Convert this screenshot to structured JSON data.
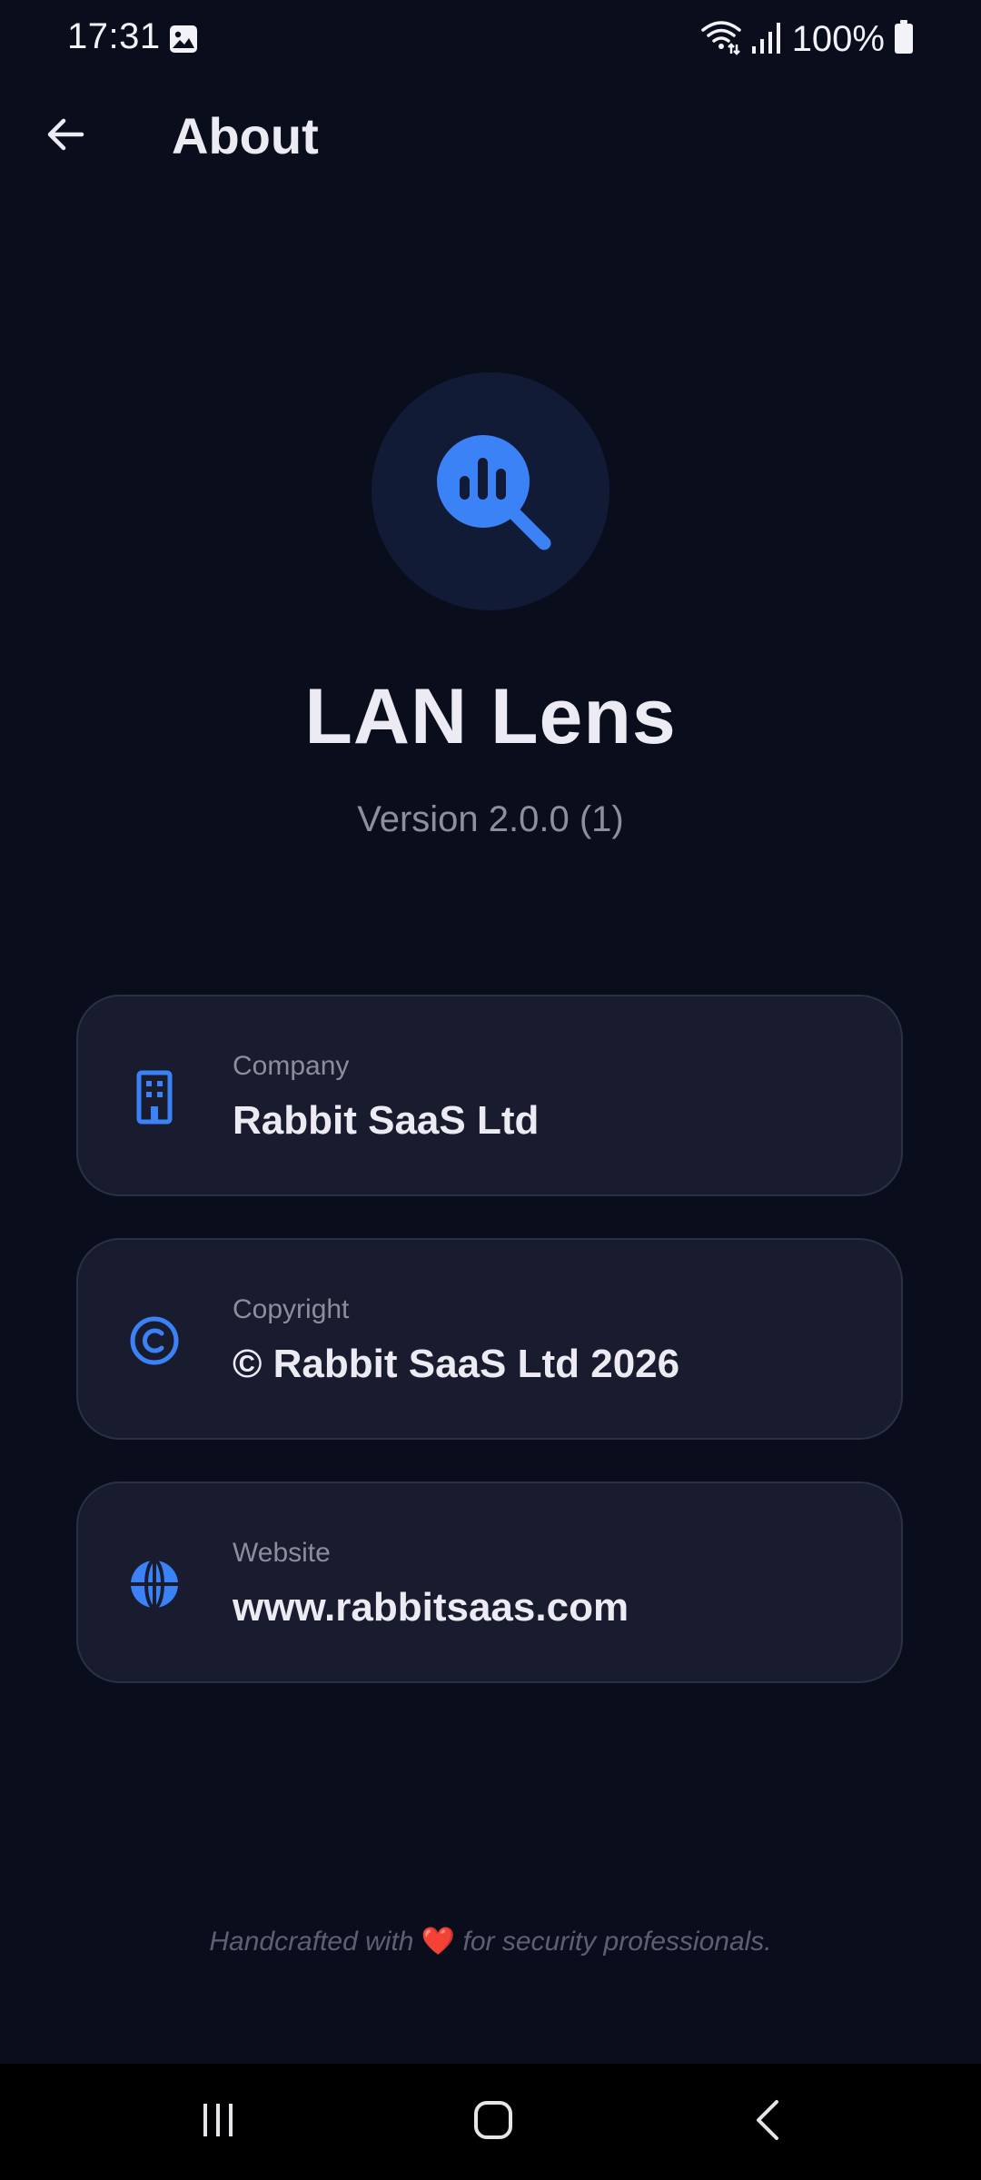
{
  "status_bar": {
    "time": "17:31",
    "battery_text": "100%",
    "icons": [
      "gallery-icon",
      "wifi-icon",
      "signal-icon",
      "battery-icon"
    ]
  },
  "app_bar": {
    "title": "About",
    "back_icon": "arrow-left-icon"
  },
  "app_info": {
    "logo_icon": "magnifier-chart-icon",
    "name": "LAN Lens",
    "version": "Version 2.0.0 (1)"
  },
  "cards": {
    "company": {
      "label": "Company",
      "value": "Rabbit SaaS Ltd",
      "icon": "building-icon"
    },
    "copyright": {
      "label": "Copyright",
      "value": "© Rabbit SaaS Ltd 2026",
      "icon": "copyright-icon"
    },
    "website": {
      "label": "Website",
      "value": "www.rabbitsaas.com",
      "icon": "globe-icon"
    }
  },
  "footer": {
    "before": "Handcrafted with ",
    "heart": "❤️",
    "after": " for security professionals."
  },
  "nav_bar": {
    "icons": [
      "recents-icon",
      "home-icon",
      "back-icon"
    ]
  },
  "colors": {
    "background": "#0a0e1c",
    "accent": "#3b82f6",
    "card_background": "#181c2e",
    "logo_circle": "#111b36"
  }
}
